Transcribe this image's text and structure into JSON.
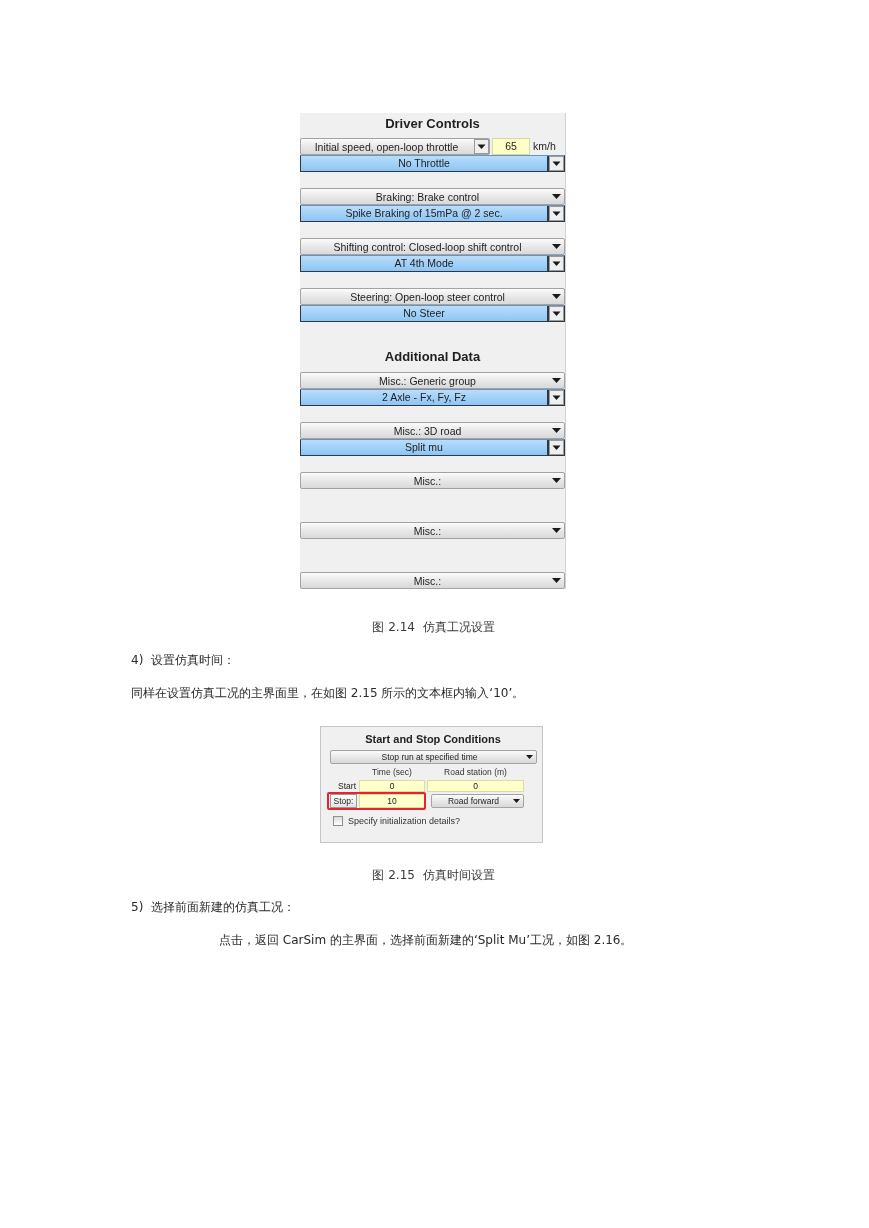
{
  "figure_1": {
    "sections": [
      {
        "title": "Driver Controls",
        "groups": [
          {
            "kind": "speed",
            "selector": "Initial speed, open-loop throttle",
            "speed": "65",
            "unit": "km/h",
            "dataset": "No Throttle"
          },
          {
            "kind": "plain",
            "selector": "Braking: Brake control",
            "dataset": "Spike Braking of 15mPa @ 2 sec."
          },
          {
            "kind": "plain",
            "selector": "Shifting control: Closed-loop shift control",
            "dataset": "AT 4th Mode"
          },
          {
            "kind": "plain",
            "selector": "Steering: Open-loop steer control",
            "dataset": "No Steer"
          }
        ]
      },
      {
        "title": "Additional Data",
        "groups": [
          {
            "kind": "plain",
            "selector": "Misc.: Generic group",
            "dataset": "2 Axle - Fx, Fy, Fz"
          },
          {
            "kind": "plain",
            "selector": "Misc.: 3D road",
            "dataset": "Split mu"
          },
          {
            "kind": "plain",
            "selector": "Misc.:"
          },
          {
            "kind": "plain",
            "selector": "Misc.:"
          },
          {
            "kind": "plain",
            "selector": "Misc.:"
          }
        ]
      }
    ],
    "caption": "图 2.14  仿真工况设置"
  },
  "step_4": {
    "heading": "4)  设置仿真时间：",
    "text": "同样在设置仿真工况的主界面里，在如图 2.15 所示的文本框内输入‘10’。"
  },
  "figure_2": {
    "title": "Start and Stop Conditions",
    "stop_mode": "Stop run at specified time",
    "columns": [
      "Time (sec)",
      "Road station (m)"
    ],
    "rows": [
      {
        "kind": "input",
        "label": "Start",
        "time": "0",
        "station": "0",
        "highlighted": false
      },
      {
        "kind": "dropdown",
        "label": "Stop:",
        "time": "10",
        "station": "Road forward",
        "highlighted": true
      }
    ],
    "checkbox": {
      "label": "Specify initialization details?",
      "checked": false
    },
    "caption": "图 2.15  仿真时间设置"
  },
  "step_5": {
    "heading": "5)  选择前面新建的仿真工况：",
    "text": "点击，返回 CarSim 的主界面，选择前面新建的‘Split Mu’工况，如图 2.16。"
  }
}
